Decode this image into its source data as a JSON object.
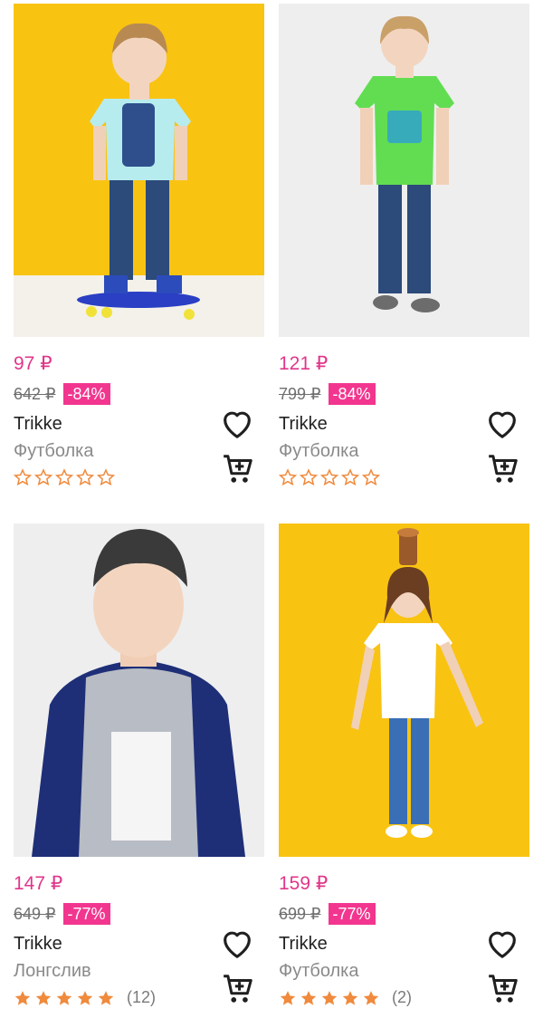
{
  "colors": {
    "price": "#e0368a",
    "discount_bg": "#f2368f",
    "star": "#f08a3c",
    "photo_yellow": "#f9c312",
    "photo_gray": "#eeeeee"
  },
  "products": [
    {
      "price": "97 ₽",
      "old_price": "642 ₽",
      "discount": "-84%",
      "brand": "Trikke",
      "type": "Футболка",
      "rating": 0,
      "reviews": "",
      "photo_bg": "yellow",
      "favorite_icon": "heart-outline-icon",
      "cart_icon": "cart-icon"
    },
    {
      "price": "121 ₽",
      "old_price": "799 ₽",
      "discount": "-84%",
      "brand": "Trikke",
      "type": "Футболка",
      "rating": 0,
      "reviews": "",
      "photo_bg": "gray",
      "favorite_icon": "heart-outline-icon",
      "cart_icon": "cart-icon"
    },
    {
      "price": "147 ₽",
      "old_price": "649 ₽",
      "discount": "-77%",
      "brand": "Trikke",
      "type": "Лонгслив",
      "rating": 5,
      "reviews": "(12)",
      "photo_bg": "gray",
      "favorite_icon": "heart-outline-icon",
      "cart_icon": "cart-icon"
    },
    {
      "price": "159 ₽",
      "old_price": "699 ₽",
      "discount": "-77%",
      "brand": "Trikke",
      "type": "Футболка",
      "rating": 5,
      "reviews": "(2)",
      "photo_bg": "yellow",
      "favorite_icon": "heart-outline-icon",
      "cart_icon": "cart-icon"
    }
  ]
}
